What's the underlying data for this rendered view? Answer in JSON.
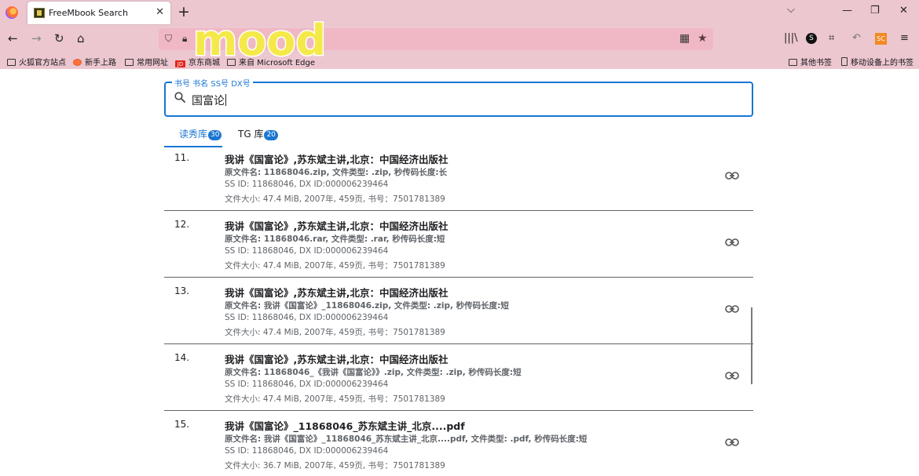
{
  "browser": {
    "tab_title": "FreeMbook Search",
    "url_text": "",
    "bookmarks": [
      {
        "label": "火狐官方站点"
      },
      {
        "label": "新手上路"
      },
      {
        "label": "常用网址"
      },
      {
        "label": "京东商城",
        "icon_text": "JD"
      },
      {
        "label": "来自 Microsoft Edge"
      },
      {
        "label": "其他书签"
      },
      {
        "label": "移动设备上的书签"
      }
    ],
    "sticker_text": "mood",
    "toolbar_badge_s": "S",
    "toolbar_badge_sc": "SC"
  },
  "search": {
    "legend": "书号 书名 SS号 DX号",
    "value": "国富论"
  },
  "library_tabs": [
    {
      "label": "读秀库",
      "count": "30",
      "active": true
    },
    {
      "label": "TG 库",
      "count": "20",
      "active": false
    }
  ],
  "results": [
    {
      "num": "11.",
      "title": "我讲《国富论》,苏东斌主讲,北京：中国经济出版社",
      "original_name": "原文件名: 11868046.zip, 文件类型: .zip, 秒传码长度:长",
      "ids": "SS ID: 11868046, DX ID:000006239464",
      "meta": "文件大小: 47.4 MiB, 2007年, 459页, 书号：7501781389"
    },
    {
      "num": "12.",
      "title": "我讲《国富论》,苏东斌主讲,北京：中国经济出版社",
      "original_name": "原文件名: 11868046.rar, 文件类型: .rar, 秒传码长度:短",
      "ids": "SS ID: 11868046, DX ID:000006239464",
      "meta": "文件大小: 47.4 MiB, 2007年, 459页, 书号：7501781389"
    },
    {
      "num": "13.",
      "title": "我讲《国富论》,苏东斌主讲,北京：中国经济出版社",
      "original_name": "原文件名: 我讲《国富论》_11868046.zip, 文件类型: .zip, 秒传码长度:短",
      "ids": "SS ID: 11868046, DX ID:000006239464",
      "meta": "文件大小: 47.4 MiB, 2007年, 459页, 书号：7501781389"
    },
    {
      "num": "14.",
      "title": "我讲《国富论》,苏东斌主讲,北京：中国经济出版社",
      "original_name": "原文件名: 11868046_《我讲《国富论》》.zip, 文件类型: .zip, 秒传码长度:短",
      "ids": "SS ID: 11868046, DX ID:000006239464",
      "meta": "文件大小: 47.4 MiB, 2007年, 459页, 书号：7501781389"
    },
    {
      "num": "15.",
      "title": "我讲《国富论》_11868046_苏东斌主讲_北京....pdf",
      "original_name": "原文件名: 我讲《国富论》_11868046_苏东斌主讲_北京....pdf, 文件类型: .pdf, 秒传码长度:短",
      "ids": "SS ID: 11868046, DX ID:000006239464",
      "meta": "文件大小: 36.7 MiB, 2007年, 459页, 书号：7501781389"
    }
  ],
  "colors": {
    "accent": "#1976d2",
    "chrome": "#ecc7cf",
    "urlbar": "#f0b8c4"
  }
}
